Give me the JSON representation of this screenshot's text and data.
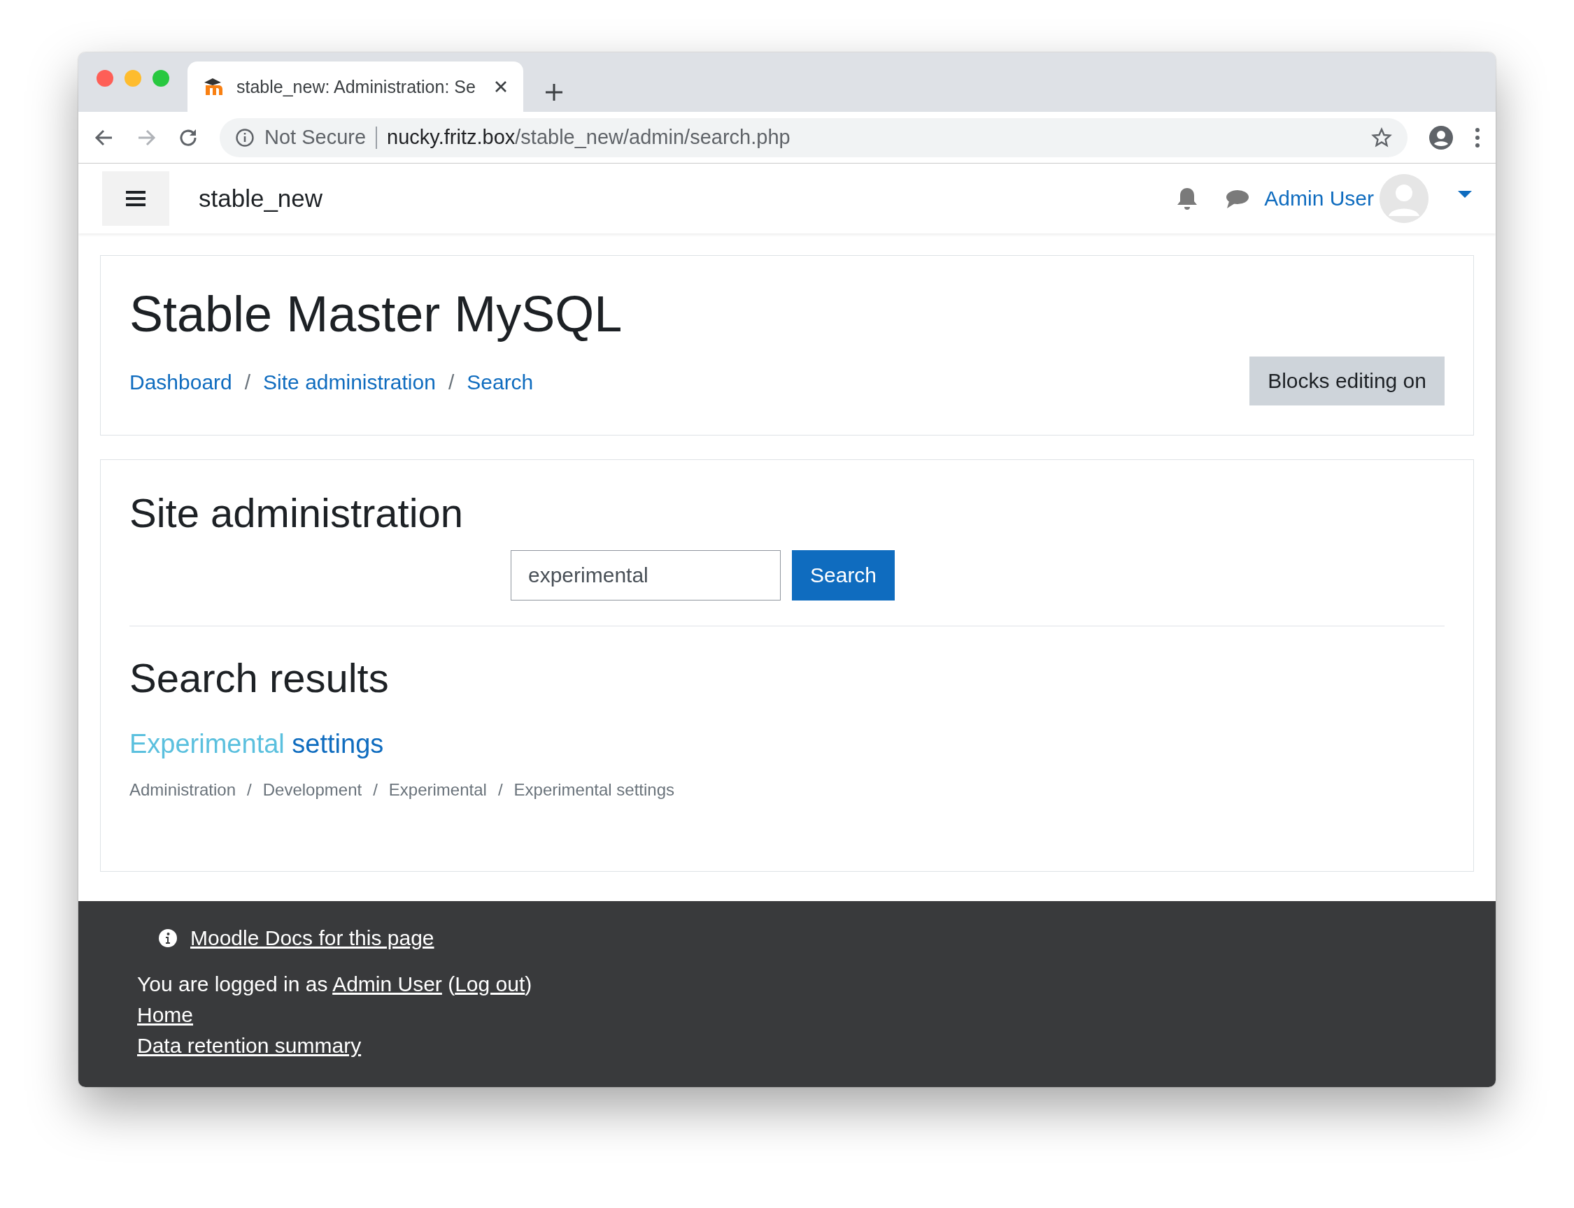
{
  "browser": {
    "tab": {
      "title": "stable_new: Administration: Se"
    },
    "address": {
      "security": "Not Secure",
      "host": "nucky.fritz.box",
      "path": "/stable_new/admin/search.php"
    }
  },
  "navbar": {
    "site_name": "stable_new",
    "user_name": "Admin User"
  },
  "page_header": {
    "title": "Stable Master MySQL",
    "breadcrumbs": [
      "Dashboard",
      "Site administration",
      "Search"
    ],
    "separator": "/",
    "edit_button": "Blocks editing on"
  },
  "admin": {
    "heading": "Site administration",
    "search": {
      "value": "experimental",
      "button": "Search"
    },
    "results_heading": "Search results",
    "results": [
      {
        "title": [
          {
            "text": "Experimental",
            "highlighted": true
          },
          {
            "text": " settings",
            "highlighted": false
          }
        ],
        "path": [
          "Administration",
          "Development",
          "Experimental",
          "Experimental settings"
        ],
        "separator": "/"
      }
    ]
  },
  "footer": {
    "docs_link": "Moodle Docs for this page",
    "login": [
      {
        "kind": "text",
        "text": "You are logged in as "
      },
      {
        "kind": "link",
        "text": "Admin User"
      },
      {
        "kind": "text",
        "text": " ("
      },
      {
        "kind": "link",
        "text": "Log out"
      },
      {
        "kind": "text",
        "text": ")"
      }
    ],
    "links": [
      "Home",
      "Data retention summary"
    ]
  }
}
